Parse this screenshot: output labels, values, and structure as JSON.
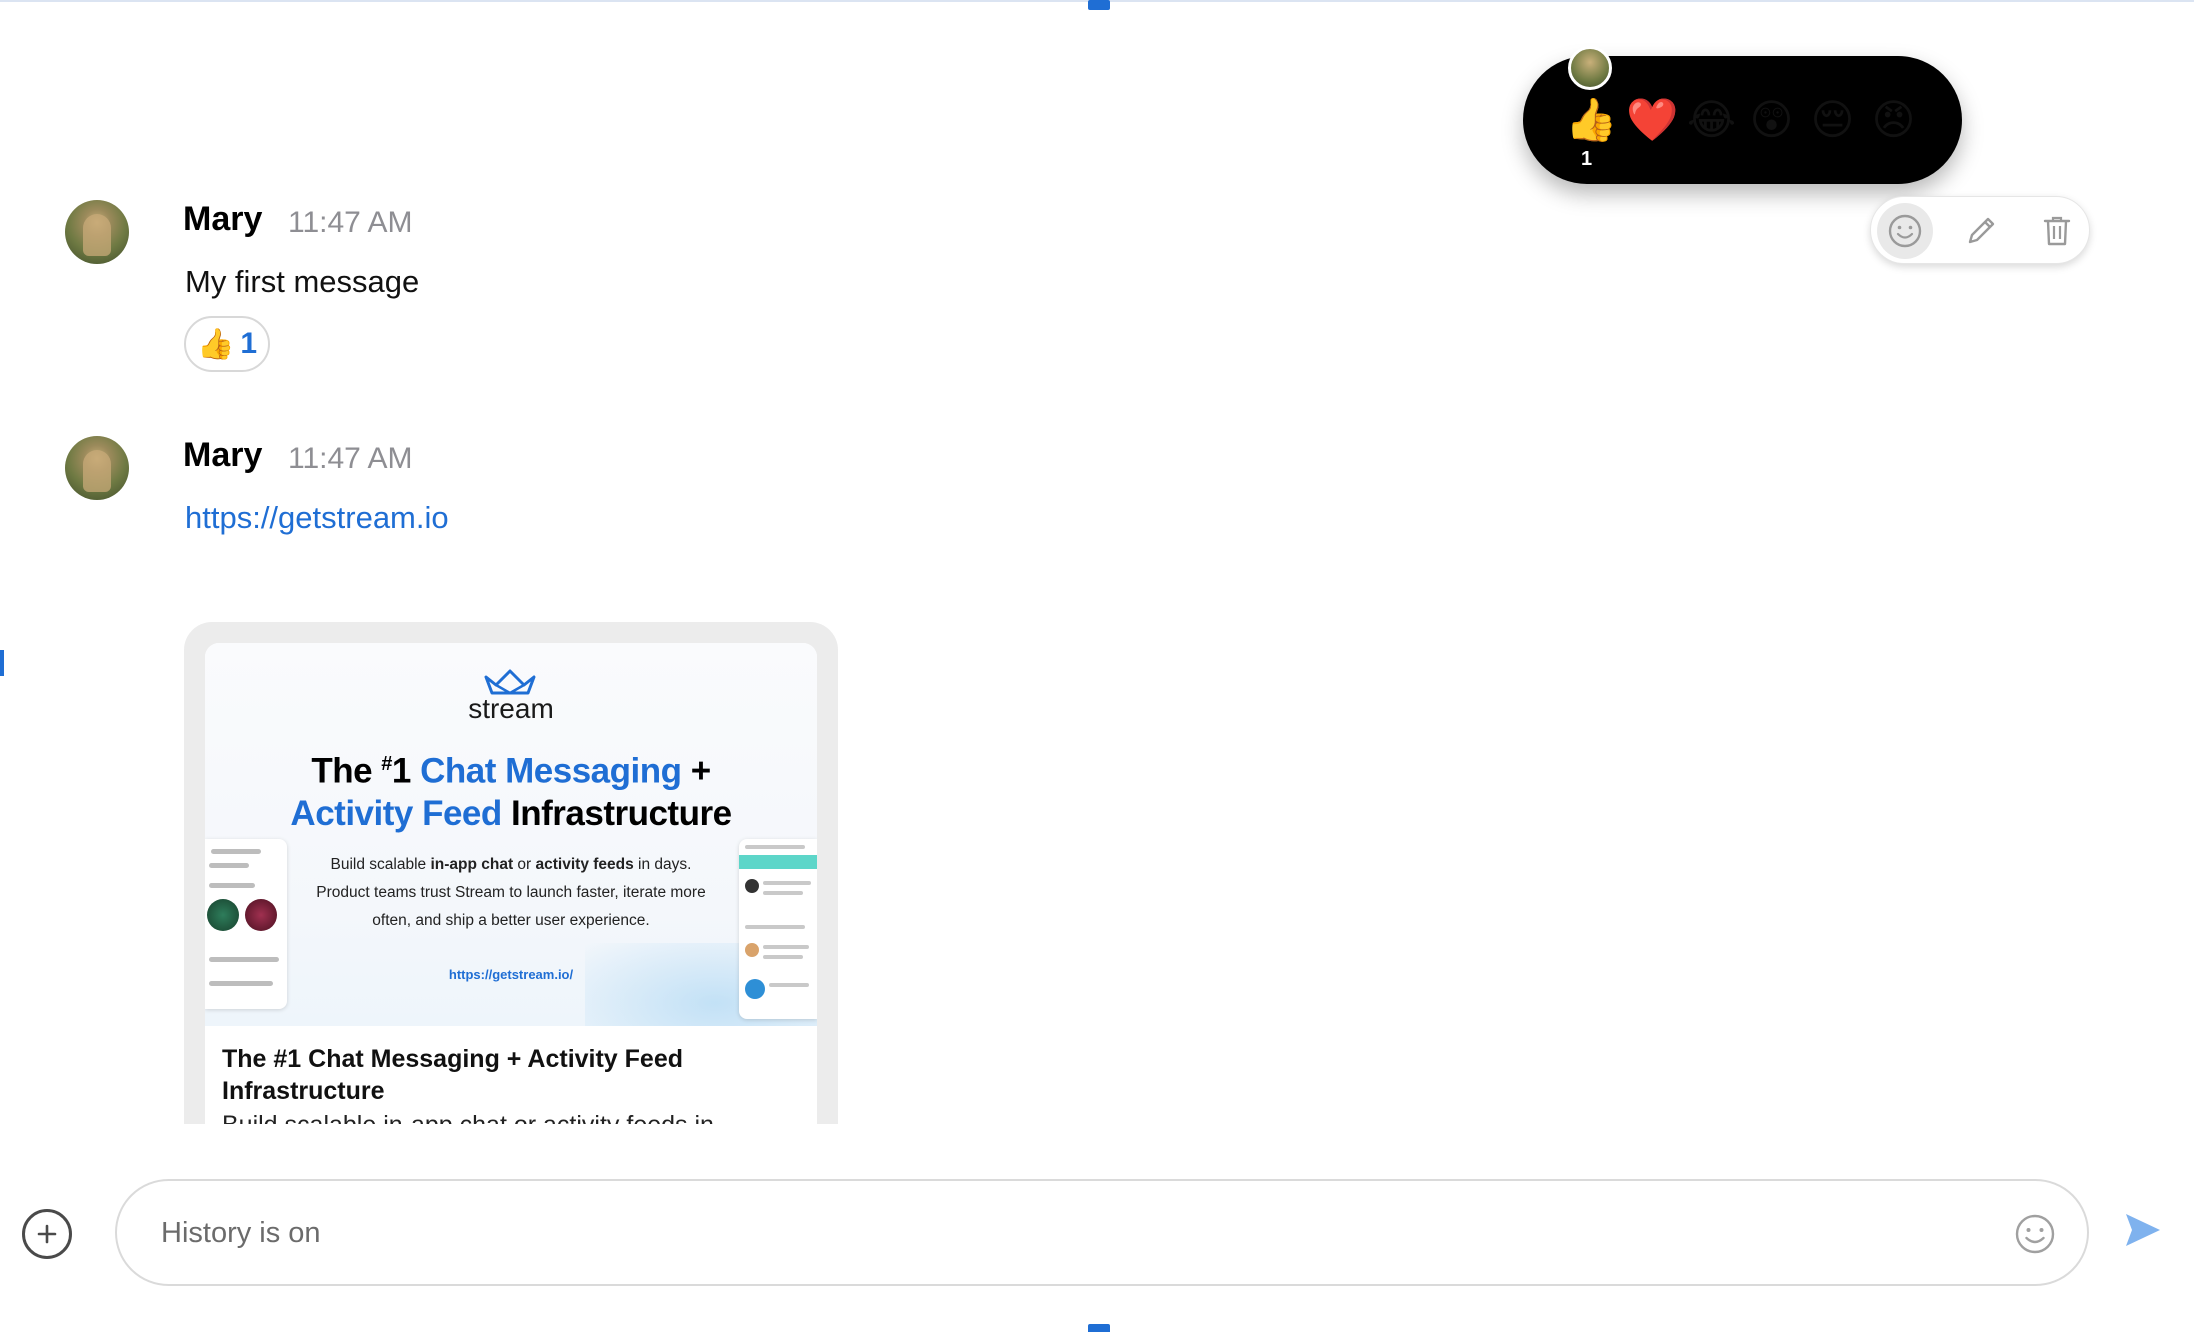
{
  "colors": {
    "accent": "#1f6ed4",
    "selector_bg": "#000000",
    "muted_text": "#8e8e93",
    "border": "#dadada"
  },
  "messages": [
    {
      "author": "Mary",
      "time": "11:47 AM",
      "text": "My first message",
      "reaction": {
        "emoji": "👍",
        "count": "1"
      }
    },
    {
      "author": "Mary",
      "time": "11:47 AM",
      "link": "https://getstream.io"
    }
  ],
  "reaction_selector": {
    "emojis": [
      "👍",
      "❤️",
      "😂",
      "😲",
      "😔",
      "😠"
    ],
    "count": "1"
  },
  "message_actions": {
    "icons": [
      "emoji-icon",
      "edit-icon",
      "delete-icon"
    ]
  },
  "link_preview": {
    "brand": "stream",
    "headline_prefix": "The ",
    "headline_sup": "#",
    "headline_num": "1 ",
    "headline_blue1": "Chat Messaging",
    "headline_plus": " +",
    "headline_blue2": "Activity Feed",
    "headline_suffix": " Infrastructure",
    "sub_1": "Build scalable ",
    "sub_bold1": "in-app chat",
    "sub_2": " or ",
    "sub_bold2": "activity feeds",
    "sub_3": " in days. Product teams trust Stream to launch faster, iterate more often, and ship a better user experience.",
    "image_url": "https://getstream.io/",
    "title": "The #1 Chat Messaging + Activity Feed Infrastructure",
    "description": "Build scalable in-app chat or activity feeds in"
  },
  "composer": {
    "placeholder": "History is on"
  }
}
